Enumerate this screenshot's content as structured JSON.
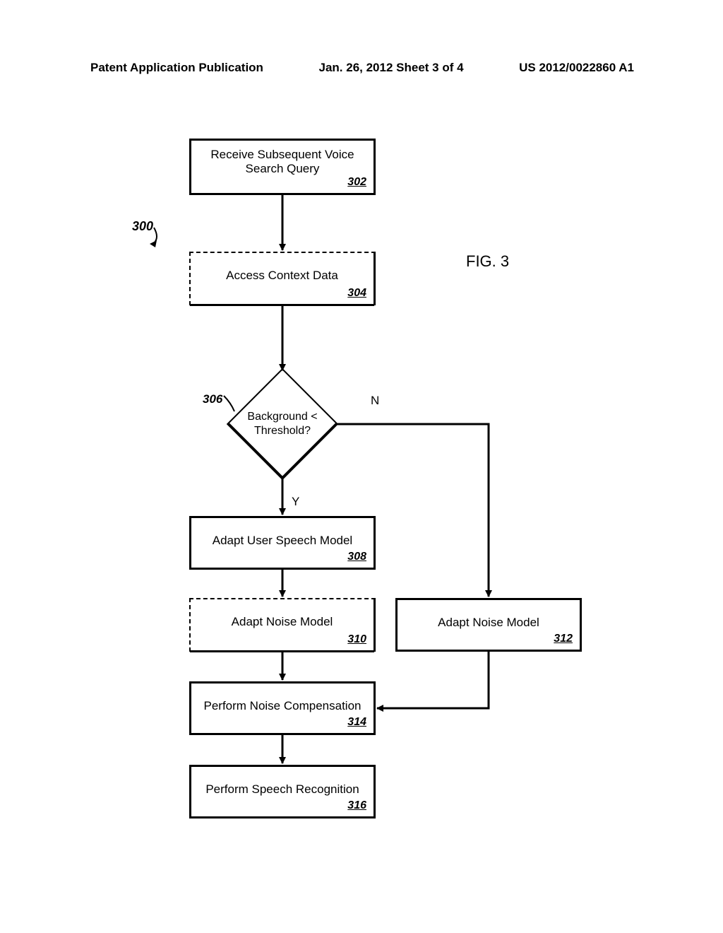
{
  "header": {
    "left": "Patent Application Publication",
    "center": "Jan. 26, 2012  Sheet 3 of 4",
    "right": "US 2012/0022860 A1"
  },
  "figure": {
    "label": "FIG. 3",
    "leader_ref": "300"
  },
  "boxes": {
    "b302": {
      "title": "Receive Subsequent Voice Search Query",
      "ref": "302"
    },
    "b304": {
      "title": "Access Context Data",
      "ref": "304"
    },
    "b308": {
      "title": "Adapt User Speech Model",
      "ref": "308"
    },
    "b310": {
      "title": "Adapt Noise Model",
      "ref": "310"
    },
    "b312": {
      "title": "Adapt Noise Model",
      "ref": "312"
    },
    "b314": {
      "title": "Perform Noise Compensation",
      "ref": "314"
    },
    "b316": {
      "title": "Perform Speech Recognition",
      "ref": "316"
    }
  },
  "decision": {
    "ref": "306",
    "line1": "Background <",
    "line2": "Threshold?",
    "yes": "Y",
    "no": "N"
  }
}
